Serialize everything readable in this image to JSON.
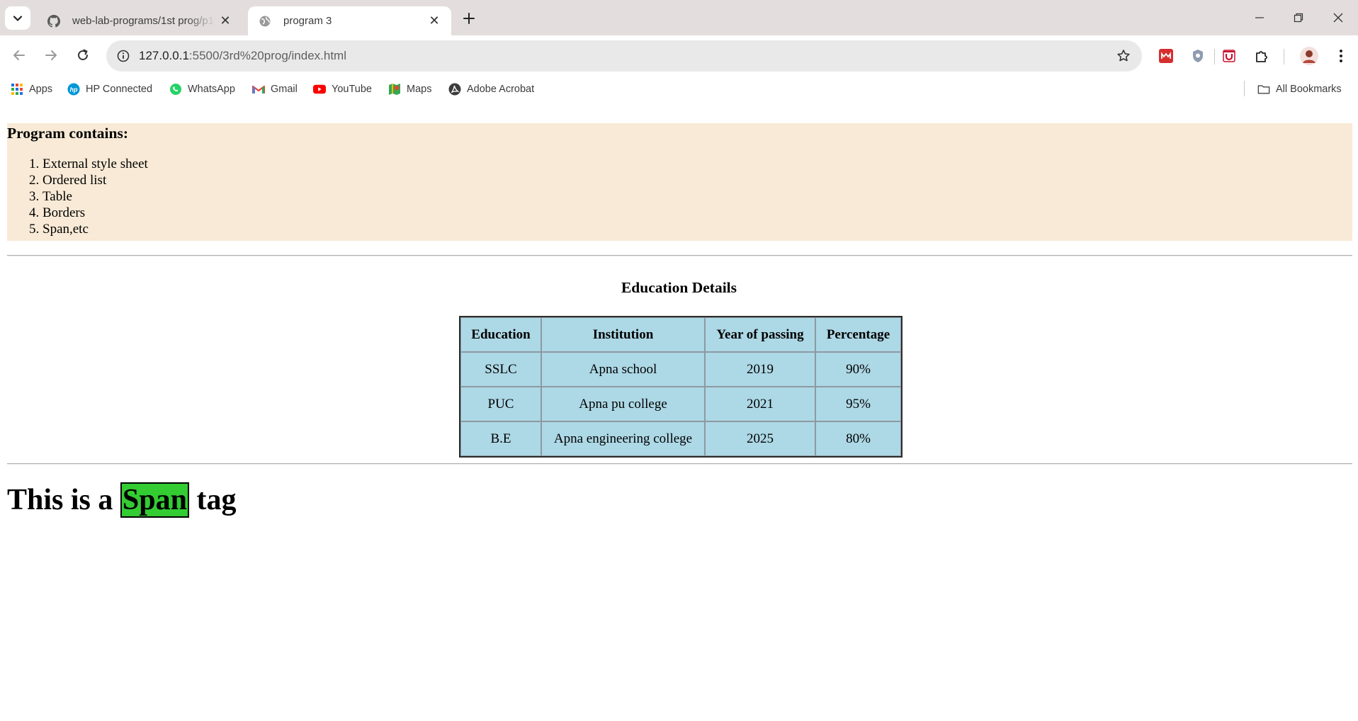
{
  "browser": {
    "tabs": [
      {
        "title": "web-lab-programs/1st prog/p1",
        "favicon": "github-icon",
        "active": false
      },
      {
        "title": "program 3",
        "favicon": "globe-icon",
        "active": true
      }
    ],
    "url": {
      "host": "127.0.0.1",
      "path": ":5500/3rd%20prog/index.html"
    },
    "bookmarks": [
      {
        "label": "Apps",
        "icon": "apps-grid-icon"
      },
      {
        "label": "HP Connected",
        "icon": "hp-icon"
      },
      {
        "label": "WhatsApp",
        "icon": "whatsapp-icon"
      },
      {
        "label": "Gmail",
        "icon": "gmail-icon"
      },
      {
        "label": "YouTube",
        "icon": "youtube-icon"
      },
      {
        "label": "Maps",
        "icon": "maps-icon"
      },
      {
        "label": "Adobe Acrobat",
        "icon": "acrobat-icon"
      }
    ],
    "all_bookmarks": "All Bookmarks"
  },
  "page": {
    "program": {
      "heading": "Program contains:",
      "items": [
        "External style sheet",
        "Ordered list",
        "Table",
        "Borders",
        "Span,etc"
      ],
      "background": "#f8ead6"
    },
    "education": {
      "title": "Education Details",
      "headers": [
        "Education",
        "Institution",
        "Year of passing",
        "Percentage"
      ],
      "rows": [
        [
          "SSLC",
          "Apna school",
          "2019",
          "90%"
        ],
        [
          "PUC",
          "Apna pu college",
          "2021",
          "95%"
        ],
        [
          "B.E",
          "Apna engineering college",
          "2025",
          "80%"
        ]
      ],
      "background": "#add8e6"
    },
    "span_line": {
      "before": "This is a ",
      "highlight": "Span",
      "after": " tag",
      "highlight_color": "#33cc33"
    }
  }
}
